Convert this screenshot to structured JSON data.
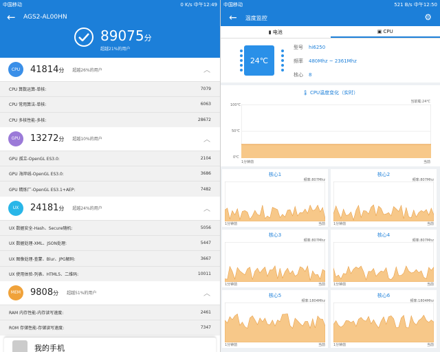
{
  "left": {
    "status": {
      "carrier": "中国移动",
      "right": "0 K/s  中午12:49"
    },
    "device": "AGS2-AL00HN",
    "total": {
      "score": "89075",
      "unit": "分",
      "subtitle": "超越21%的用户"
    },
    "categories": [
      {
        "badge": "CPU",
        "color": "#3a8fe8",
        "score": "41814",
        "unit": "分",
        "percent": "超越26%的用户",
        "items": [
          {
            "label": "CPU 算数运算-单核:",
            "value": "7079"
          },
          {
            "label": "CPU 常用算法-单核:",
            "value": "6063"
          },
          {
            "label": "CPU 多核性能-多核:",
            "value": "28672"
          }
        ]
      },
      {
        "badge": "GPU",
        "color": "#9b7ad8",
        "score": "13272",
        "unit": "分",
        "percent": "超越10%的用户",
        "items": [
          {
            "label": "GPU 孤立-OpenGL ES3.0:",
            "value": "2104"
          },
          {
            "label": "GPU 海岸线-OpenGL ES3.0:",
            "value": "3686"
          },
          {
            "label": "GPU 精炼厂-OpenGL ES3.1+AEP:",
            "value": "7482"
          }
        ]
      },
      {
        "badge": "UX",
        "color": "#29b6e8",
        "score": "24181",
        "unit": "分",
        "percent": "超越24%的用户",
        "items": [
          {
            "label": "UX 数据安全-Hash、Secure随机:",
            "value": "5056"
          },
          {
            "label": "UX 数据处理-XML、JSON处理:",
            "value": "5447"
          },
          {
            "label": "UX 图像处理-查蒙、Blur、JPG解码:",
            "value": "3667"
          },
          {
            "label": "UX 使用体验-列表、HTML5、二维码:",
            "value": "10011"
          }
        ]
      },
      {
        "badge": "MEM",
        "color": "#f0a23a",
        "score": "9808",
        "unit": "分",
        "percent": "超越51%的用户",
        "items": [
          {
            "label": "RAM 内存性能-内存读写速度:",
            "value": "2461"
          },
          {
            "label": "ROM 存储性能-存储读写速度:",
            "value": "7347"
          }
        ]
      }
    ],
    "card_label": "我的手机"
  },
  "right": {
    "status": {
      "carrier": "中国移动",
      "right": "521 B/s  中午12:50"
    },
    "title": "温度监控",
    "tabs": [
      "电池",
      "CPU"
    ],
    "temp": "24℃",
    "info": [
      {
        "k": "型号",
        "v": "hi6250"
      },
      {
        "k": "频率",
        "v": "480Mhz ~ 2361Mhz"
      },
      {
        "k": "核心",
        "v": "8"
      }
    ],
    "temp_chart": {
      "title": "CPU温度变化（实时）",
      "current": "当前载:24℃",
      "y_labels": [
        "100℃",
        "50℃",
        "0℃"
      ],
      "x_start": "1分钟前",
      "x_end": "当前"
    },
    "cores": [
      {
        "name": "核心1",
        "freq": "频率:807Mhz"
      },
      {
        "name": "核心2",
        "freq": "频率:807Mhz"
      },
      {
        "name": "核心3",
        "freq": "频率:807Mhz"
      },
      {
        "name": "核心4",
        "freq": "频率:807Mhz"
      },
      {
        "name": "核心5",
        "freq": "频率:1804Mhz"
      },
      {
        "name": "核心6",
        "freq": "频率:1804Mhz"
      }
    ],
    "core_axis": {
      "start": "1分钟前",
      "end": "当前"
    },
    "fill_color": "#f7c889",
    "line_color": "#e8a04a"
  }
}
